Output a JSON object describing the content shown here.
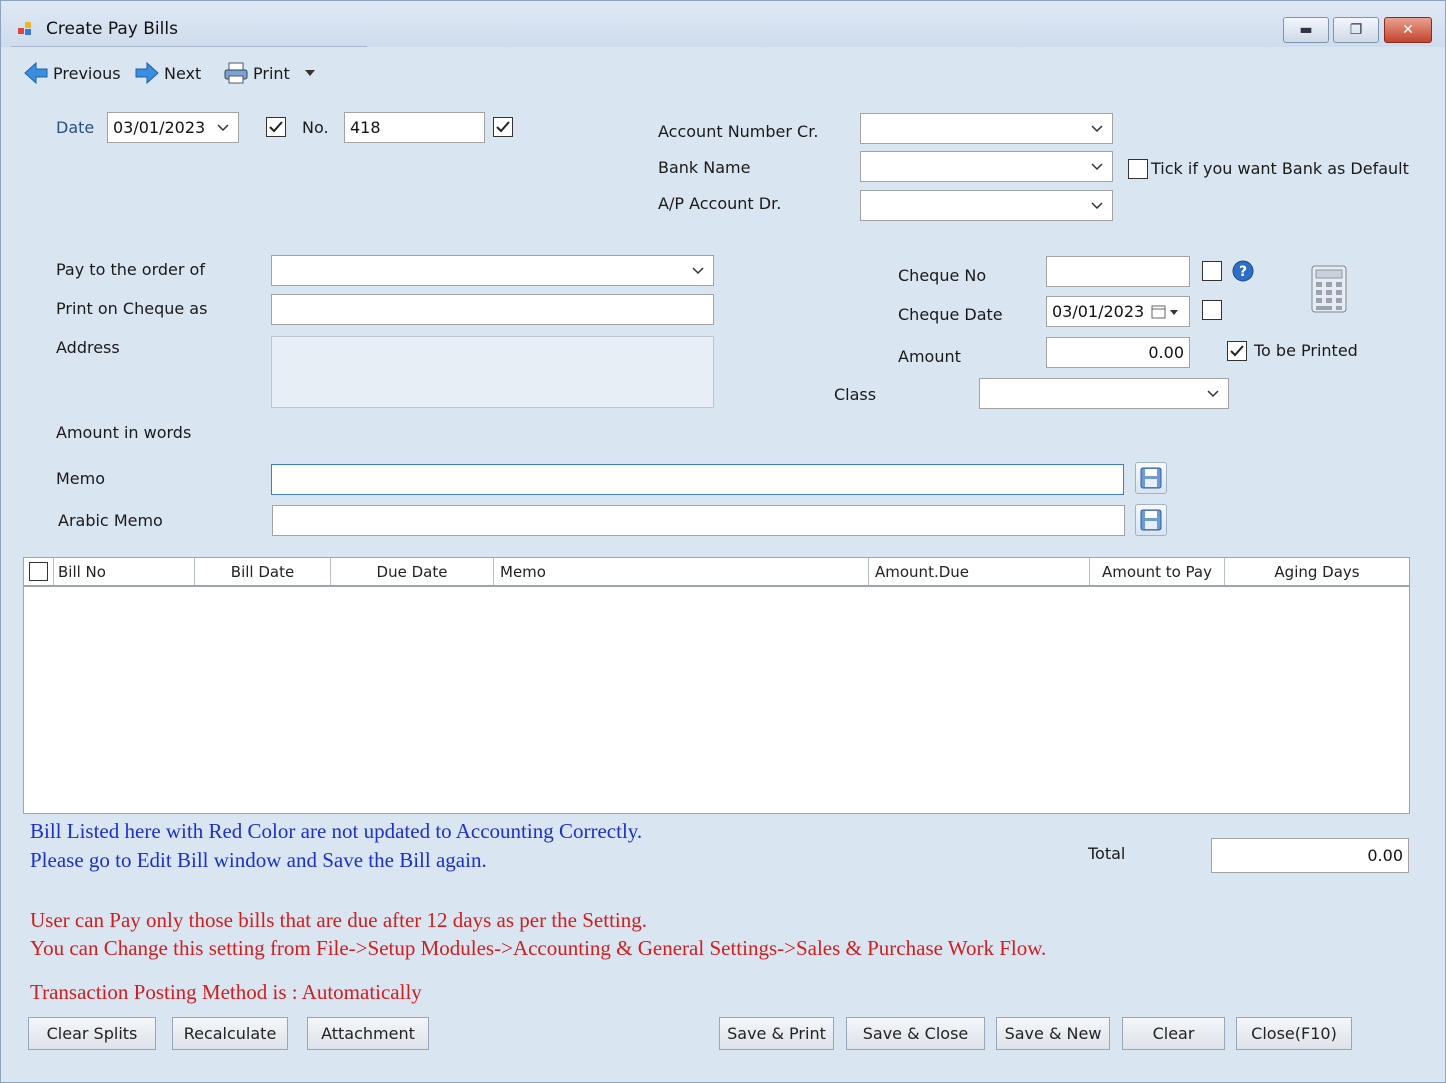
{
  "window": {
    "title": "Create Pay Bills"
  },
  "toolbar": {
    "previous": "Previous",
    "next": "Next",
    "print": "Print"
  },
  "header": {
    "date_label": "Date",
    "date_value": "03/01/2023",
    "no_label": "No.",
    "no_value": "418",
    "account_number_cr_label": "Account Number Cr.",
    "bank_name_label": "Bank Name",
    "bank_default_label": "Tick if you want Bank as Default",
    "ap_account_dr_label": "A/P Account Dr."
  },
  "payee": {
    "pay_to_label": "Pay to the order of",
    "print_on_cheque_label": "Print on Cheque as",
    "address_label": "Address",
    "amount_in_words_label": "Amount in words",
    "memo_label": "Memo",
    "arabic_memo_label": "Arabic Memo"
  },
  "cheque": {
    "cheque_no_label": "Cheque No",
    "cheque_date_label": "Cheque Date",
    "cheque_date_value": "03/01/2023",
    "amount_label": "Amount",
    "amount_value": "0.00",
    "to_be_printed_label": "To be Printed",
    "class_label": "Class"
  },
  "grid": {
    "columns": [
      "Bill No",
      "Bill Date",
      "Due Date",
      "Memo",
      "Amount.Due",
      "Amount to Pay",
      "Aging Days"
    ],
    "rows": []
  },
  "total": {
    "label": "Total",
    "value": "0.00"
  },
  "messages": {
    "blue_line1": "Bill Listed here with Red Color are not updated to Accounting Correctly.",
    "blue_line2": "Please go to Edit Bill window and Save the Bill again.",
    "red_line1": "User can Pay only those bills that are due after 12 days as per the Setting.",
    "red_line2": "You can Change this setting from File->Setup Modules->Accounting & General Settings->Sales & Purchase Work Flow.",
    "posting": "Transaction Posting Method is : Automatically"
  },
  "buttons": {
    "clear_splits": "Clear Splits",
    "recalculate": "Recalculate",
    "attachment": "Attachment",
    "save_print": "Save & Print",
    "save_close": "Save & Close",
    "save_new": "Save & New",
    "clear": "Clear",
    "close": "Close(F10)"
  },
  "colors": {
    "info_blue": "#1b2fd0",
    "warning_red": "#d01e1e",
    "window_bg": "#d9e6f2"
  }
}
